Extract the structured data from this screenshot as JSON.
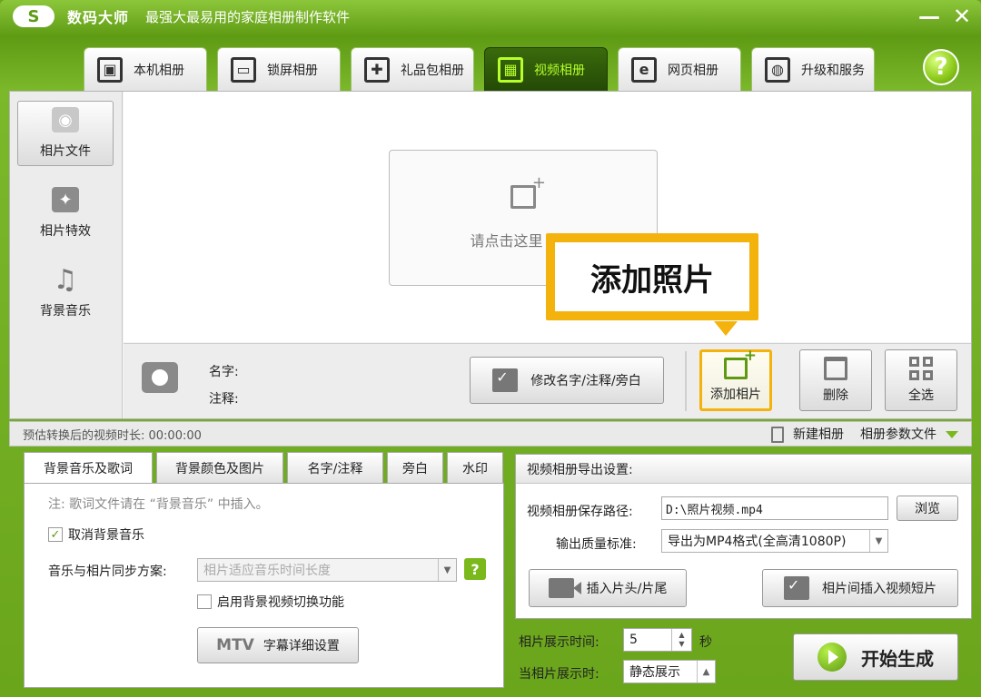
{
  "titlebar": {
    "logo": "S",
    "app_name": "数码大师",
    "subtitle": "最强大最易用的家庭相册制作软件",
    "minimize": "—",
    "close": "✕"
  },
  "tabs": [
    {
      "label": "本机相册",
      "icon": "photo-album-icon",
      "glyph": "▣"
    },
    {
      "label": "锁屏相册",
      "icon": "monitor-icon",
      "glyph": "▭"
    },
    {
      "label": "礼品包相册",
      "icon": "gift-icon",
      "glyph": "✚"
    },
    {
      "label": "视频相册",
      "icon": "film-icon",
      "glyph": "▦",
      "active": true
    },
    {
      "label": "网页相册",
      "icon": "ie-icon",
      "glyph": "e"
    },
    {
      "label": "升级和服务",
      "icon": "globe-icon",
      "glyph": "◍"
    }
  ],
  "help": "?",
  "sidebar": [
    {
      "label": "相片文件",
      "glyph": "◉",
      "active": true
    },
    {
      "label": "相片特效",
      "glyph": "✦"
    },
    {
      "label": "背景音乐",
      "glyph": "♫"
    }
  ],
  "drop_area": {
    "text": "请点击这里 添加"
  },
  "callout": {
    "text": "添加照片",
    "color": "#f4b20c"
  },
  "info": {
    "name_label": "名字:",
    "note_label": "注释:",
    "edit_button": "修改名字/注释/旁白",
    "add_button": "添加相片",
    "delete_button": "删除",
    "select_all_button": "全选"
  },
  "strip": {
    "duration_text": "预估转换后的视频时长: 00:00:00",
    "new_album": "新建相册",
    "album_params": "相册参数文件"
  },
  "bottom_left": {
    "tabs": [
      "背景音乐及歌词",
      "背景颜色及图片",
      "名字/注释",
      "旁白",
      "水印"
    ],
    "note": "注: 歌词文件请在 “背景音乐” 中插入。",
    "cancel_music": "取消背景音乐",
    "sync_label": "音乐与相片同步方案:",
    "sync_value": "相片适应音乐时间长度",
    "help": "?",
    "enable_switch": "启用背景视频切换功能",
    "mtv_logo": "MTV",
    "mtv_button": "字幕详细设置"
  },
  "bottom_right": {
    "title": "视频相册导出设置:",
    "save_path_label": "视频相册保存路径:",
    "save_path_value": "D:\\照片视频.mp4",
    "browse_button": "浏览",
    "quality_label": "输出质量标准:",
    "quality_value": "导出为MP4格式(全高清1080P)",
    "insert_head_tail": "插入片头/片尾",
    "insert_clip": "相片间插入视频短片"
  },
  "display": {
    "time_label": "相片展示时间:",
    "time_value": "5",
    "time_unit": "秒",
    "when_label": "当相片展示时:",
    "when_value": "静态展示",
    "start_button": "开始生成"
  },
  "colors": {
    "brand_green": "#6aa51c",
    "active_tab_text": "#b6ff2a",
    "highlight": "#f4b20c"
  }
}
